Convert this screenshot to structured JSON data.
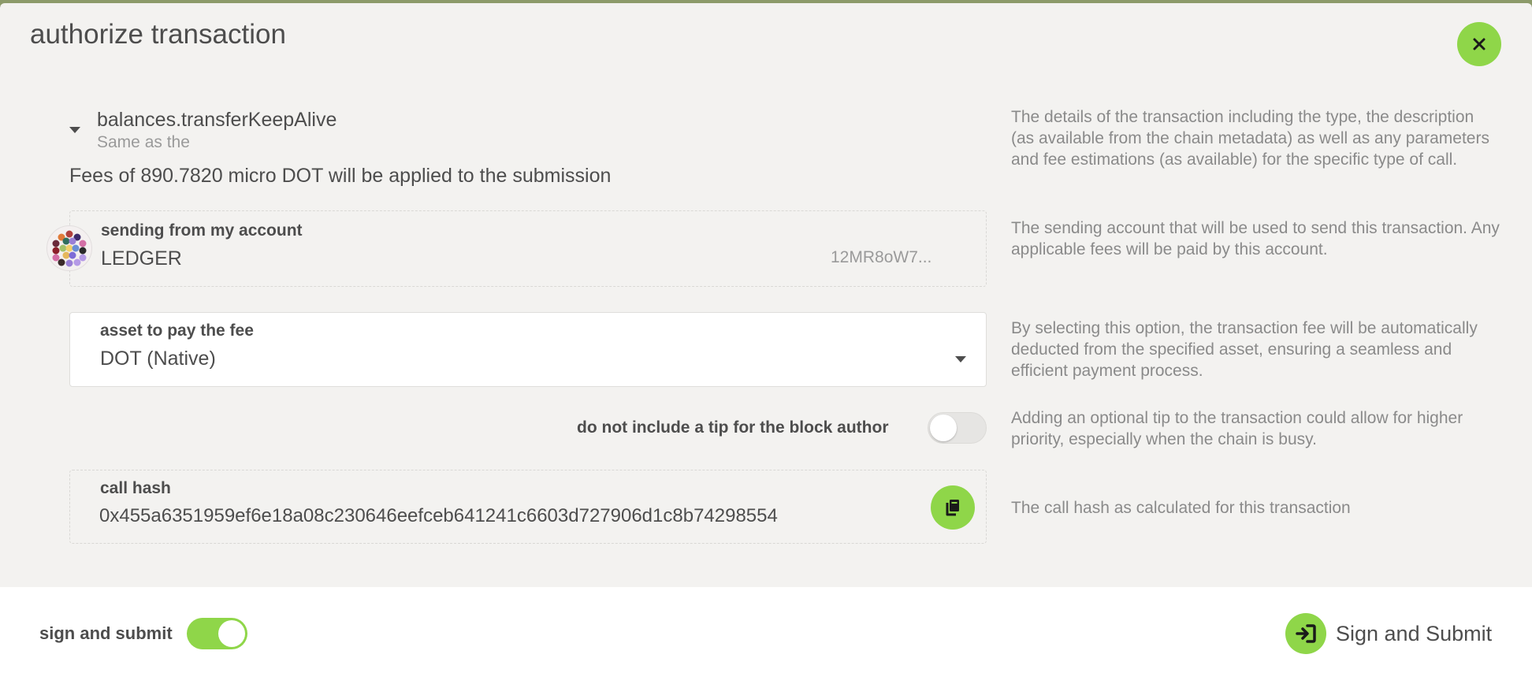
{
  "modal": {
    "title": "authorize transaction"
  },
  "call": {
    "name": "balances.transferKeepAlive",
    "description": "Same as the",
    "fees": "Fees of 890.7820 micro DOT will be applied to the submission",
    "help": "The details of the transaction including the type, the description (as available from the chain metadata) as well as any parameters and fee estimations (as available) for the specific type of call."
  },
  "sender": {
    "label": "sending from my account",
    "name": "LEDGER",
    "address_short": "12MR8oW7...",
    "help": "The sending account that will be used to send this transaction. Any applicable fees will be paid by this account."
  },
  "fee_asset": {
    "label": "asset to pay the fee",
    "value": "DOT (Native)",
    "help": "By selecting this option, the transaction fee will be automatically deducted from the specified asset, ensuring a seamless and efficient payment process."
  },
  "tip": {
    "label": "do not include a tip for the block author",
    "enabled": false,
    "help": "Adding an optional tip to the transaction could allow for higher priority, especially when the chain is busy."
  },
  "call_hash": {
    "label": "call hash",
    "value": "0x455a6351959ef6e18a08c230646eefceb641241c6603d727906d1c8b74298554",
    "help": "The call hash as calculated for this transaction"
  },
  "footer": {
    "sign_toggle_label": "sign and submit",
    "sign_toggle_enabled": true,
    "submit_label": "Sign and Submit"
  },
  "colors": {
    "accent": "#8fd649",
    "text": "#4d4d4d",
    "muted": "#8a8a8a"
  },
  "icons": [
    "close-icon",
    "caret-down-icon",
    "identicon",
    "copy-icon",
    "sign-in-icon"
  ]
}
